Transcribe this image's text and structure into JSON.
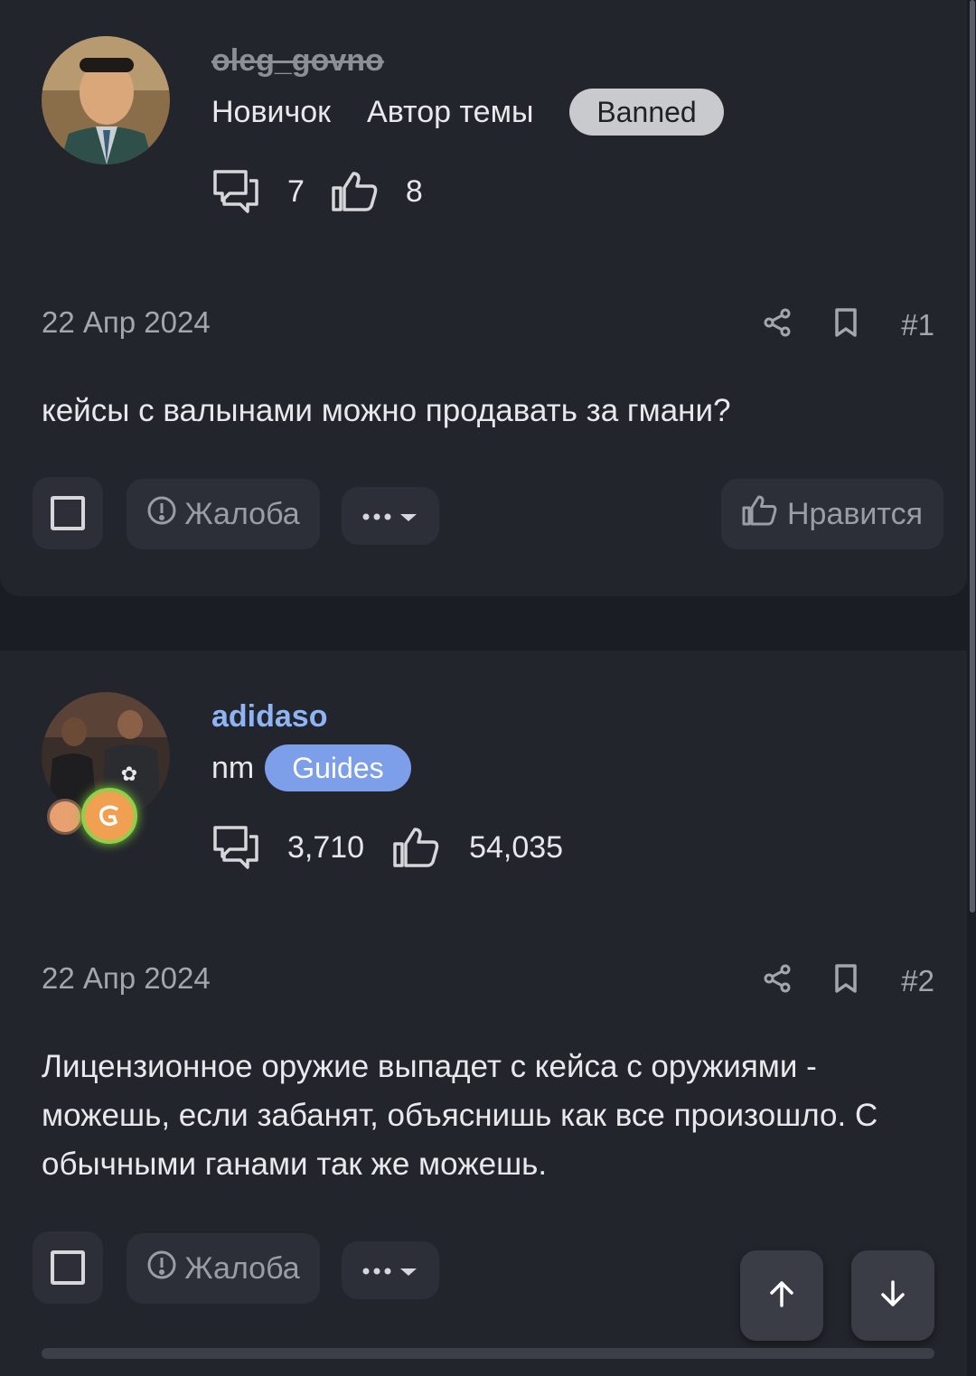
{
  "posts": [
    {
      "username": "oleg_govno",
      "rank": "Новичок",
      "role": "Автор темы",
      "badge": "Banned",
      "messages_count": "7",
      "likes_count": "8",
      "date": "22 Апр 2024",
      "number": "#1",
      "text": "кейсы с валынами можно продавать за гмани?",
      "report_label": "Жалоба",
      "like_label": "Нравится"
    },
    {
      "username": "adidaso",
      "rank": "nm",
      "badge": "Guides",
      "messages_count": "3,710",
      "likes_count": "54,035",
      "date": "22 Апр 2024",
      "number": "#2",
      "text": "Лицензионное оружие выпадет с кейса с оружиями - можешь, если забанят, объяснишь как все произошло. С обычными ганами так же можешь.",
      "report_label": "Жалоба"
    }
  ],
  "icons": {
    "messages": "chat-bubbles-icon",
    "likes": "thumbs-up-icon",
    "share": "share-icon",
    "bookmark": "bookmark-icon",
    "report": "exclamation-circle-icon",
    "more": "ellipsis-icon",
    "scroll_up": "arrow-up-icon",
    "scroll_down": "arrow-down-icon"
  },
  "colors": {
    "background": "#1b1d24",
    "card": "#23252d",
    "username_link": "#8fb4f5",
    "badge_banned": "#c9cacd",
    "badge_guides": "#7d9ee9"
  }
}
